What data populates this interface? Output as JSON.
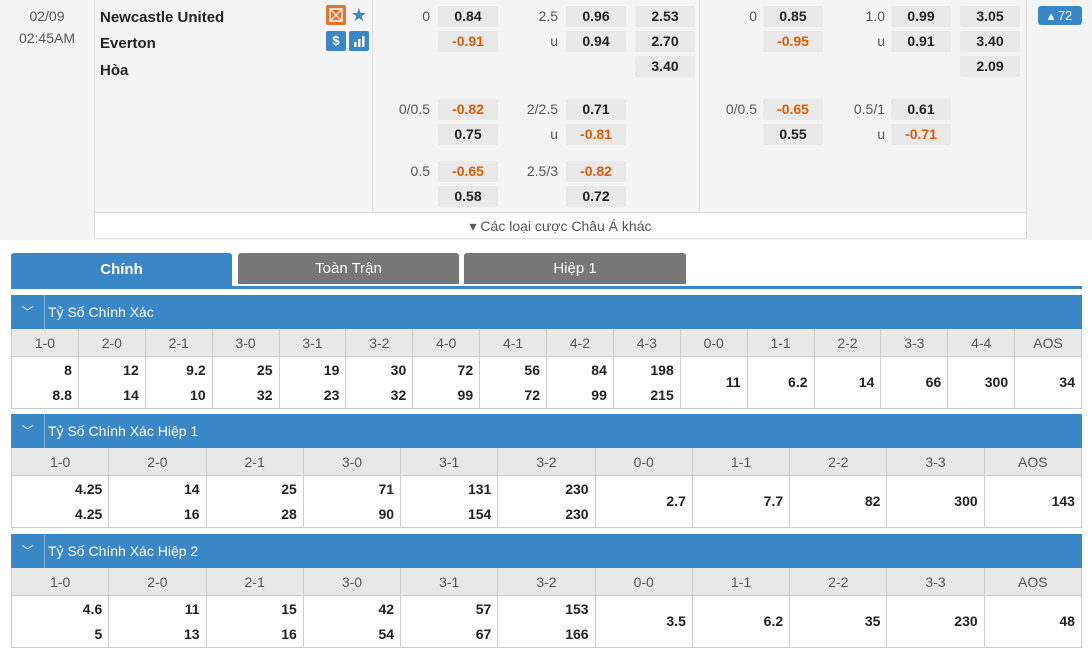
{
  "match": {
    "date": "02/09",
    "time": "02:45AM",
    "home": "Newcastle United",
    "away": "Everton",
    "draw": "Hòa",
    "icons": [
      "field-icon",
      "star-icon",
      "dollar-icon",
      "stats-icon"
    ],
    "more_bets_label": "▾ Các loại cược Châu Á khác",
    "more_count": "▴ 72",
    "ft": {
      "hdp": [
        {
          "line": "0",
          "home": "0.84",
          "away": "-0.91"
        },
        {
          "line": "0/0.5",
          "home": "-0.82",
          "away": "0.75"
        },
        {
          "line": "0.5",
          "home": "-0.65",
          "away": "0.58"
        }
      ],
      "ou": [
        {
          "line": "2.5",
          "under_label": "u",
          "over": "0.96",
          "under": "0.94"
        },
        {
          "line": "2/2.5",
          "under_label": "u",
          "over": "0.71",
          "under": "-0.81"
        },
        {
          "line": "2.5/3",
          "under_label": "",
          "over": "-0.82",
          "under": "0.72"
        }
      ],
      "x12": [
        "2.53",
        "2.70",
        "3.40"
      ]
    },
    "h1": {
      "hdp": [
        {
          "line": "0",
          "home": "0.85",
          "away": "-0.95"
        },
        {
          "line": "0/0.5",
          "home": "-0.65",
          "away": "0.55"
        }
      ],
      "ou": [
        {
          "line": "1.0",
          "under_label": "u",
          "over": "0.99",
          "under": "0.91"
        },
        {
          "line": "0.5/1",
          "under_label": "u",
          "over": "0.61",
          "under": "-0.71"
        }
      ],
      "x12": [
        "3.05",
        "3.40",
        "2.09"
      ]
    }
  },
  "tabs": [
    "Chính",
    "Toàn Trận",
    "Hiệp 1"
  ],
  "sections": [
    {
      "title": "Tỷ Số Chính Xác",
      "headers": [
        "1-0",
        "2-0",
        "2-1",
        "3-0",
        "3-1",
        "3-2",
        "4-0",
        "4-1",
        "4-2",
        "4-3",
        "0-0",
        "1-1",
        "2-2",
        "3-3",
        "4-4",
        "AOS"
      ],
      "rows": [
        [
          "8",
          "8.8"
        ],
        [
          "12",
          "14"
        ],
        [
          "9.2",
          "10"
        ],
        [
          "25",
          "32"
        ],
        [
          "19",
          "23"
        ],
        [
          "30",
          "32"
        ],
        [
          "72",
          "99"
        ],
        [
          "56",
          "72"
        ],
        [
          "84",
          "99"
        ],
        [
          "198",
          "215"
        ],
        [
          "11"
        ],
        [
          "6.2"
        ],
        [
          "14"
        ],
        [
          "66"
        ],
        [
          "300"
        ],
        [
          "34"
        ]
      ]
    },
    {
      "title": "Tỷ Số Chính Xác Hiệp 1",
      "headers": [
        "1-0",
        "2-0",
        "2-1",
        "3-0",
        "3-1",
        "3-2",
        "0-0",
        "1-1",
        "2-2",
        "3-3",
        "AOS"
      ],
      "rows": [
        [
          "4.25",
          "4.25"
        ],
        [
          "14",
          "16"
        ],
        [
          "25",
          "28"
        ],
        [
          "71",
          "90"
        ],
        [
          "131",
          "154"
        ],
        [
          "230",
          "230"
        ],
        [
          "2.7"
        ],
        [
          "7.7"
        ],
        [
          "82"
        ],
        [
          "300"
        ],
        [
          "143"
        ]
      ]
    },
    {
      "title": "Tỷ Số Chính Xác Hiệp 2",
      "headers": [
        "1-0",
        "2-0",
        "2-1",
        "3-0",
        "3-1",
        "3-2",
        "0-0",
        "1-1",
        "2-2",
        "3-3",
        "AOS"
      ],
      "rows": [
        [
          "4.6",
          "5"
        ],
        [
          "11",
          "13"
        ],
        [
          "15",
          "16"
        ],
        [
          "42",
          "54"
        ],
        [
          "57",
          "67"
        ],
        [
          "153",
          "166"
        ],
        [
          "3.5"
        ],
        [
          "6.2"
        ],
        [
          "35"
        ],
        [
          "230"
        ],
        [
          "48"
        ]
      ]
    }
  ],
  "colors": {
    "accent": "#3a87c8",
    "negative": "#e25b00",
    "tab_inactive": "#777777",
    "field_icon": "#e8742b",
    "star_icon": "#3a87c8",
    "dollar_icon": "#3a87c8"
  }
}
